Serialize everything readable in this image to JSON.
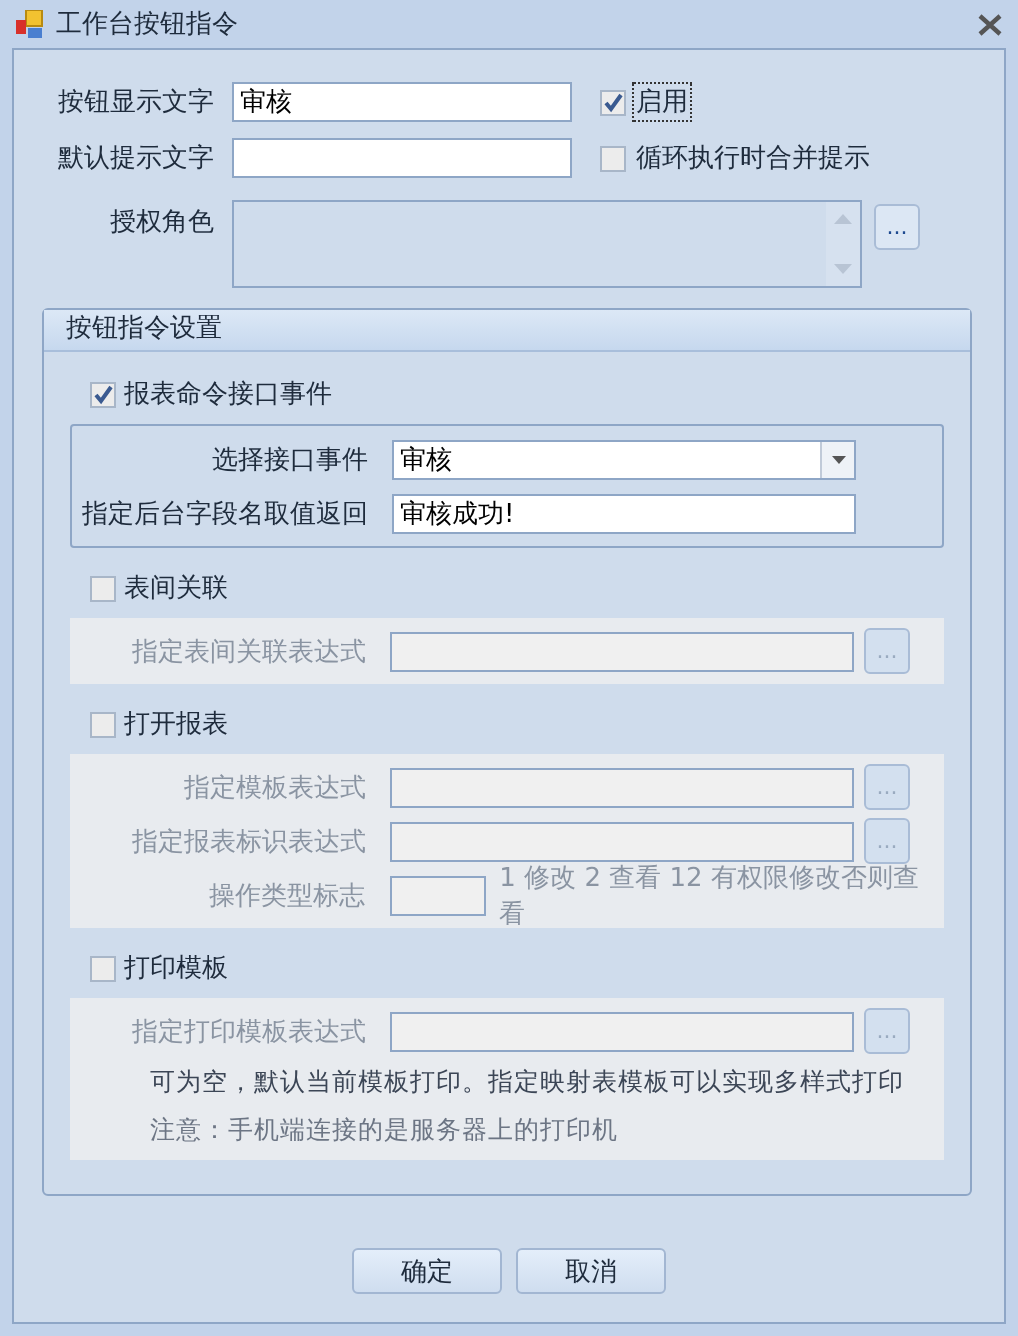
{
  "window": {
    "title": "工作台按钮指令"
  },
  "top_fields": [
    {
      "label": "按钮显示文字",
      "value": "审核",
      "option": {
        "label": "启用",
        "checked": true,
        "focused": true
      }
    },
    {
      "label": "默认提示文字",
      "option": {
        "label": "循环执行时合并提示",
        "checked": false,
        "focused": false
      }
    }
  ],
  "roles": {
    "label": "授权角色",
    "button": "..."
  },
  "group": {
    "title": "按钮指令设置",
    "sections": [
      {
        "label": "报表命令接口事件",
        "checked": true,
        "rows": [
          {
            "kind": "dropdown",
            "label": "选择接口事件",
            "value": "审核"
          },
          {
            "kind": "text",
            "label": "指定后台字段名取值返回",
            "value": "审核成功!"
          }
        ]
      },
      {
        "label": "表间关联",
        "checked": false,
        "rows": [
          {
            "kind": "browse",
            "label": "指定表间关联表达式",
            "button": "..."
          }
        ]
      },
      {
        "label": "打开报表",
        "checked": false,
        "rows": [
          {
            "kind": "browse",
            "label": "指定模板表达式",
            "button": "..."
          },
          {
            "kind": "browse",
            "label": "指定报表标识表达式",
            "button": "..."
          },
          {
            "kind": "flag",
            "label": "操作类型标志",
            "hint": "1 修改 2 查看 12 有权限修改否则查看"
          }
        ]
      },
      {
        "label": "打印模板",
        "checked": false,
        "rows": [
          {
            "kind": "browse",
            "label": "指定打印模板表达式",
            "button": "..."
          },
          {
            "kind": "note",
            "text": "可为空，默认当前模板打印。指定映射表模板可以实现多样式打印"
          },
          {
            "kind": "note",
            "text": "注意：手机端连接的是服务器上的打印机"
          }
        ]
      }
    ]
  },
  "buttons": [
    "确定",
    "取消"
  ]
}
